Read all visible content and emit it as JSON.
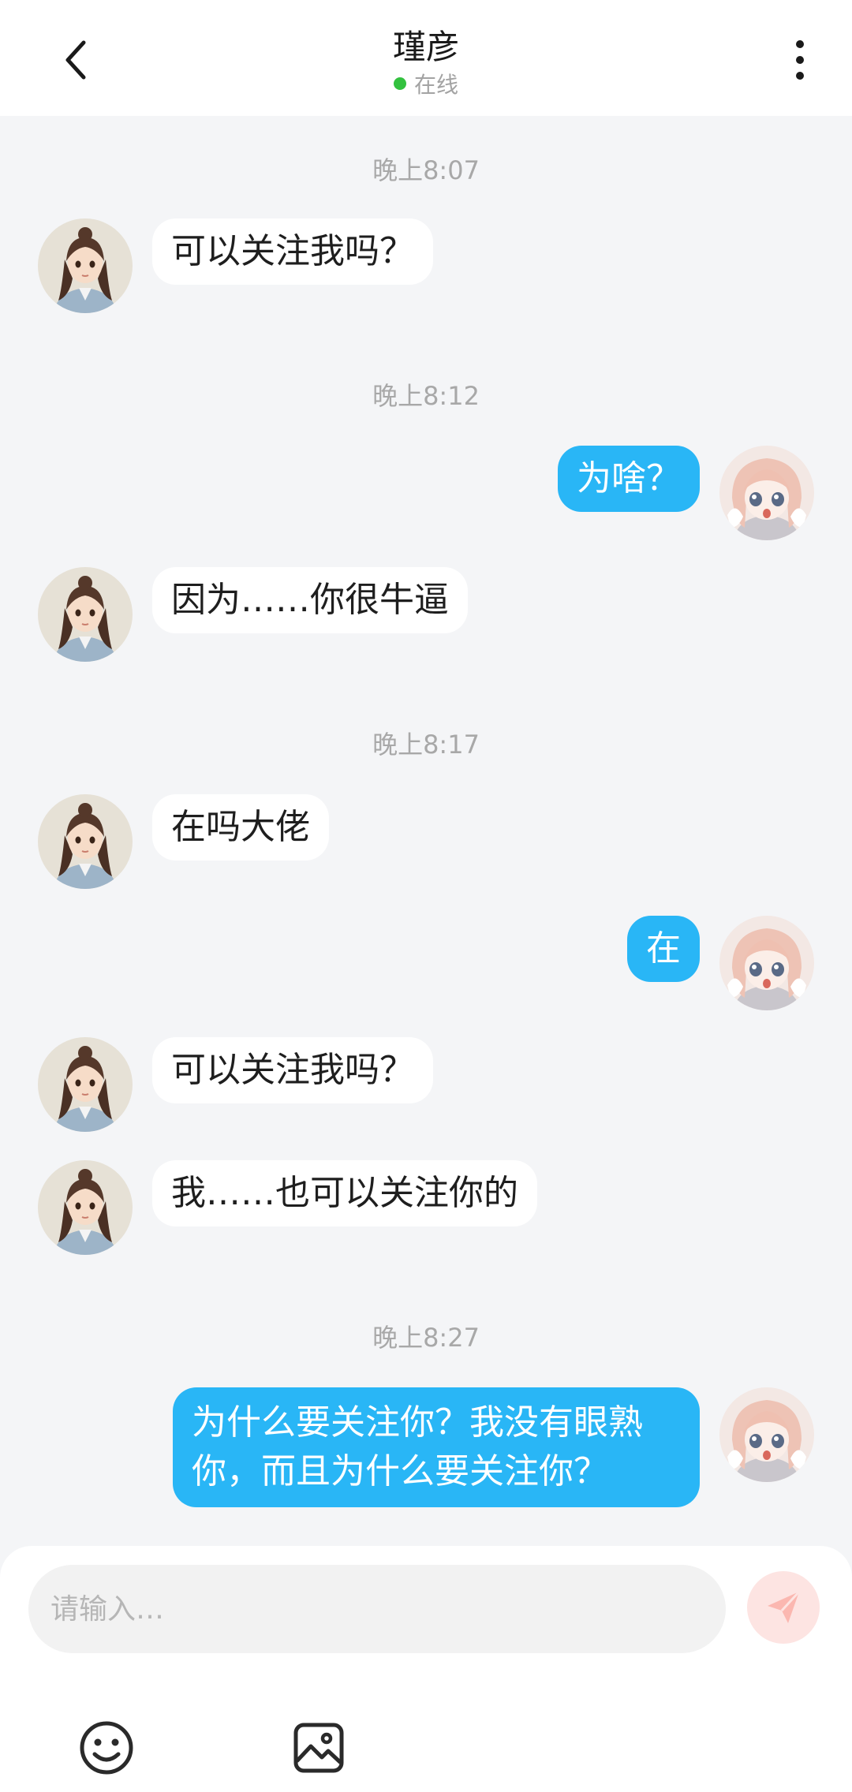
{
  "header": {
    "title": "瑾彦",
    "status": "在线",
    "status_color": "#33c13f",
    "back_icon": "chevron-left-icon",
    "more_icon": "more-vertical-icon"
  },
  "messages": [
    {
      "type": "time",
      "text": "晚上8:07"
    },
    {
      "type": "in",
      "text": "可以关注我吗？"
    },
    {
      "type": "time",
      "text": "晚上8:12"
    },
    {
      "type": "out",
      "text": "为啥？"
    },
    {
      "type": "in",
      "text": "因为……你很牛逼"
    },
    {
      "type": "time",
      "text": "晚上8:17"
    },
    {
      "type": "in",
      "text": "在吗大佬"
    },
    {
      "type": "out",
      "text": "在"
    },
    {
      "type": "in",
      "text": "可以关注我吗？"
    },
    {
      "type": "in",
      "text": "我……也可以关注你的"
    },
    {
      "type": "time",
      "text": "晚上8:27"
    },
    {
      "type": "out",
      "text": "为什么要关注你？我没有眼熟你，而且为什么要关注你？"
    }
  ],
  "input": {
    "placeholder": "请输入…",
    "send_icon": "send-icon",
    "emoji_icon": "emoji-icon",
    "image_icon": "image-icon"
  },
  "colors": {
    "outgoing_bubble": "#29b6f6",
    "incoming_bubble": "#ffffff",
    "background": "#f4f5f7",
    "send_button": "#fde4e2"
  }
}
